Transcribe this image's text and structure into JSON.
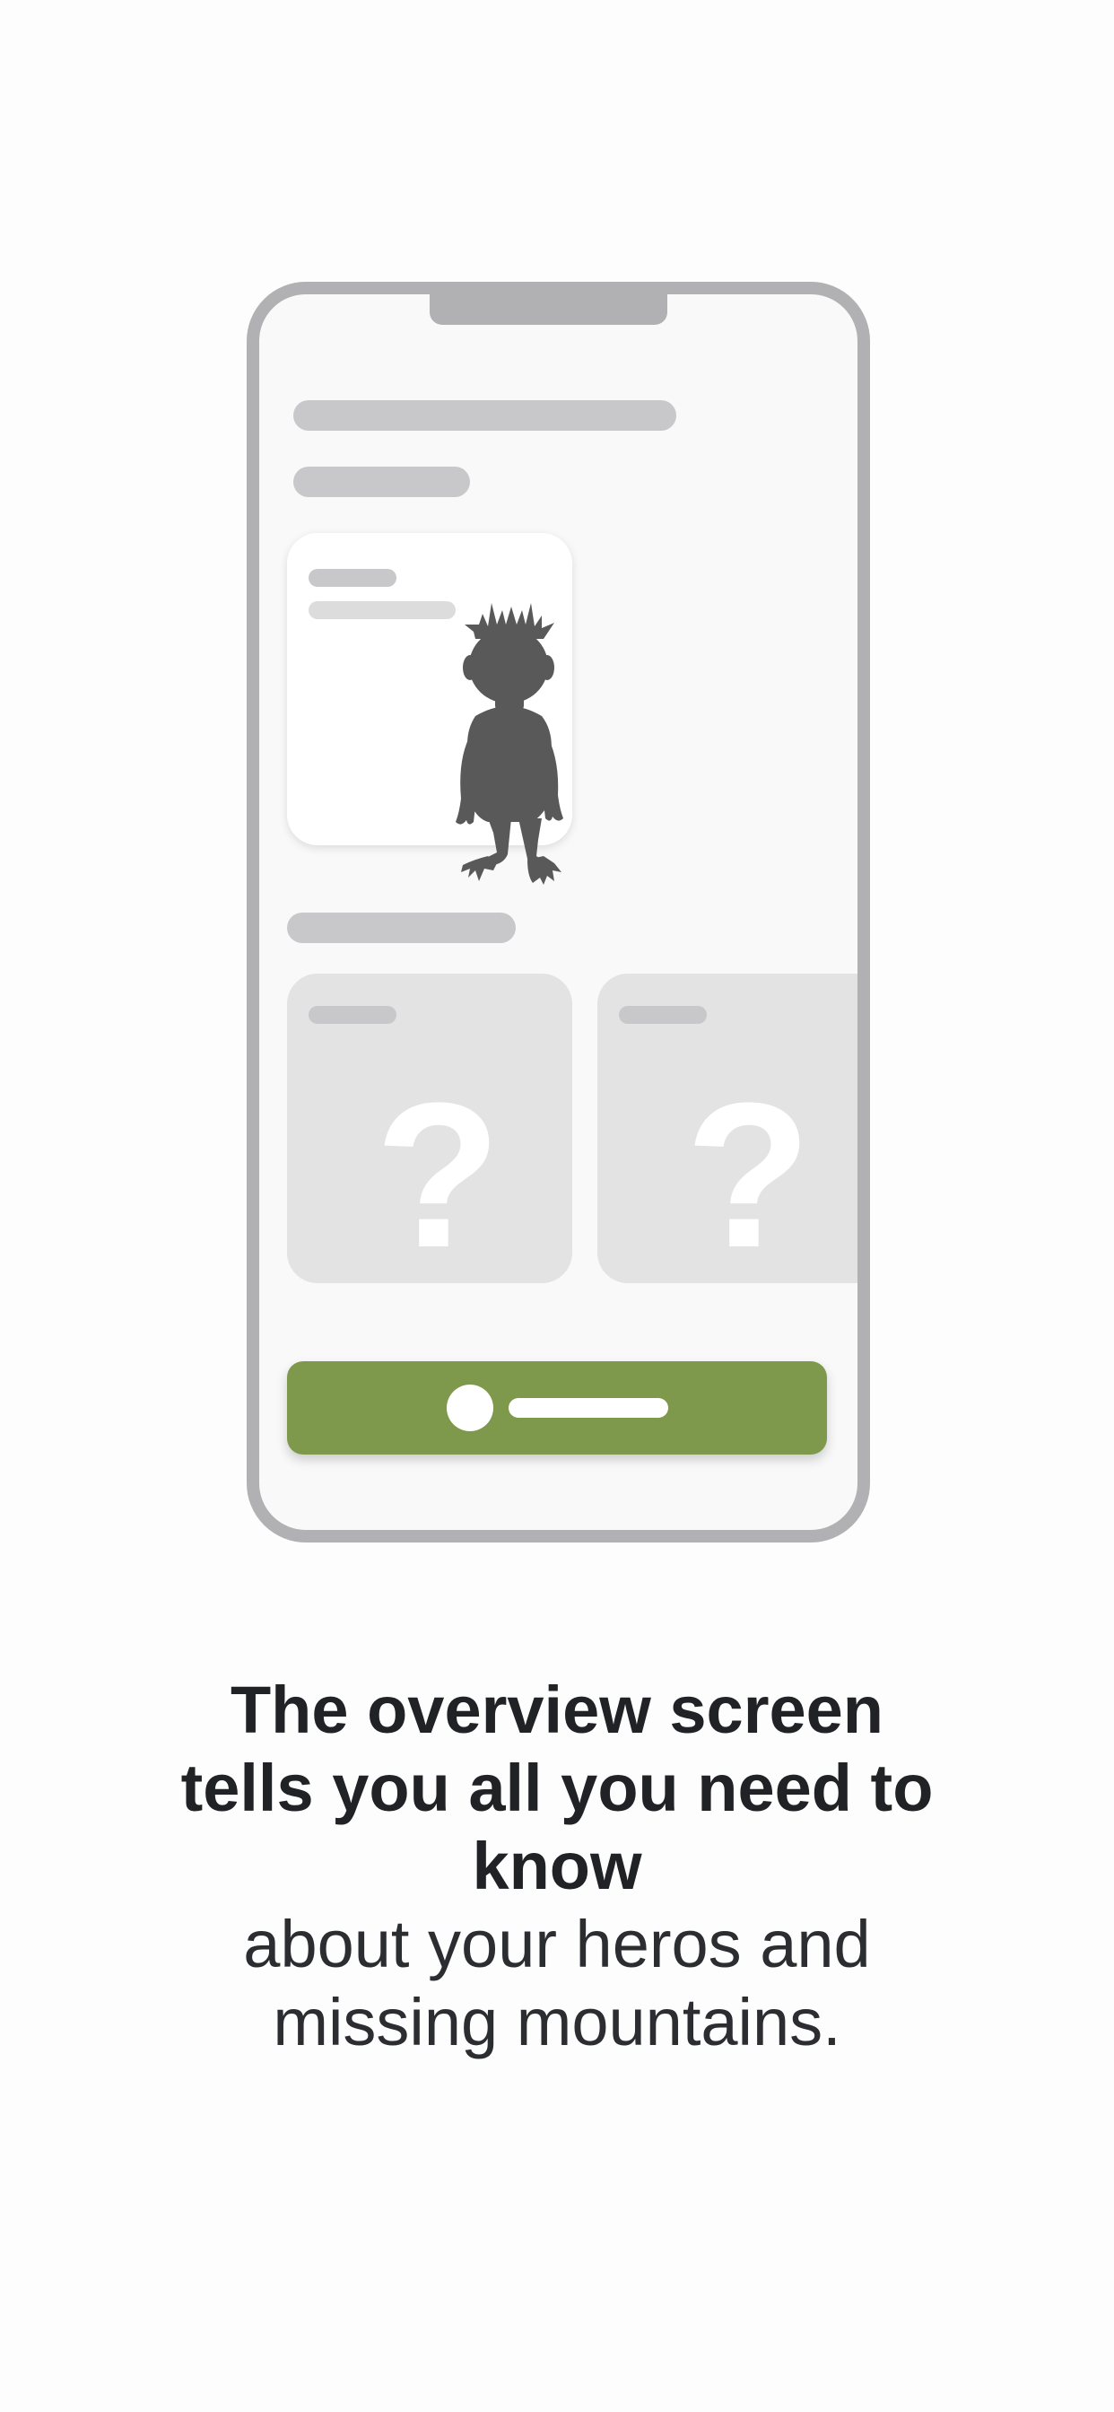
{
  "illustration": {
    "phone_frame_color": "#b1b1b3",
    "screen_background": "#f9f9fa",
    "placeholder_bar_color": "#c8c8ca",
    "hero_card": {
      "icon": "hero-silhouette-icon",
      "silhouette_color": "#595959"
    },
    "missing_cards": [
      {
        "symbol": "?"
      },
      {
        "symbol": "?"
      }
    ],
    "cta_button": {
      "color": "#7e994b",
      "icon": "dot-icon"
    }
  },
  "caption": {
    "bold": "The overview screen tells you all you need to know",
    "regular": "about your heros and missing mountains."
  }
}
